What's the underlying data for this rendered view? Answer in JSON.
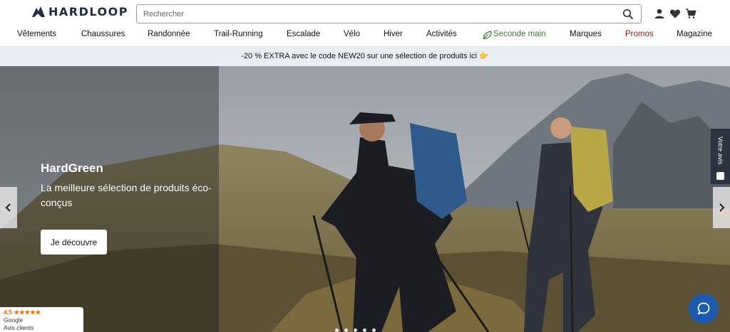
{
  "brand": {
    "name": "HARDLOOP"
  },
  "search": {
    "placeholder": "Rechercher"
  },
  "header_icons": [
    "user-icon",
    "heart-icon",
    "cart-icon"
  ],
  "nav": {
    "items": [
      {
        "label": "Vêtements"
      },
      {
        "label": "Chaussures"
      },
      {
        "label": "Randonnée"
      },
      {
        "label": "Trail-Running"
      },
      {
        "label": "Escalade"
      },
      {
        "label": "Vélo"
      },
      {
        "label": "Hiver"
      },
      {
        "label": "Activités"
      },
      {
        "label": "Seconde main"
      },
      {
        "label": "Marques"
      },
      {
        "label": "Promos"
      },
      {
        "label": "Magazine"
      }
    ]
  },
  "promo": {
    "text": "-20 % EXTRA avec le code NEW20 sur une sélection de produits ici 👉"
  },
  "hero": {
    "title": "HardGreen",
    "subtitle": "La meilleure sélection de produits éco-conçus",
    "cta": "Je découvre"
  },
  "side_widget": {
    "label": "Votre avis"
  },
  "google_badge": {
    "rating": "4,5",
    "stars": "★★★★★",
    "source": "Google",
    "caption": "Avis clients"
  },
  "colors": {
    "brand_navy": "#1b2a4a",
    "green_nav": "#3c7a30",
    "promo_red": "#b0101b",
    "promo_bar_bg": "#e9eef5",
    "chat_blue": "#1a5bb0"
  }
}
